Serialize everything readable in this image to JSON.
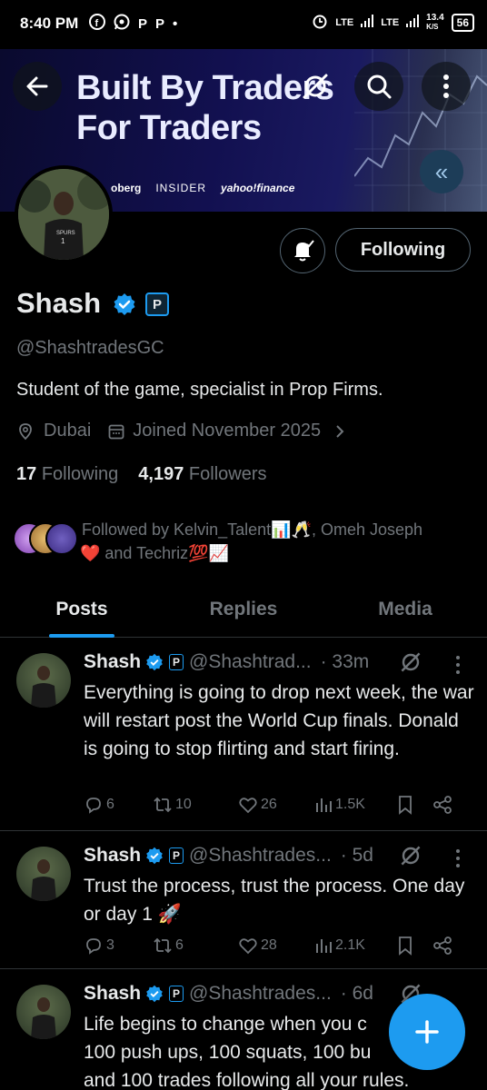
{
  "status_bar": {
    "time": "8:40 PM",
    "app_icons": [
      "facebook-icon",
      "whatsapp-icon",
      "p-icon",
      "p-icon",
      "dot"
    ],
    "p_letter": "P",
    "network1": "LTE",
    "network2": "LTE",
    "speed_value": "13.4",
    "speed_unit": "K/S",
    "battery": "56"
  },
  "banner": {
    "line1": "Built By Traders",
    "line2": "For Traders",
    "logos": [
      "oberg",
      "INSIDER",
      "yahoo!finance"
    ],
    "colors": {
      "bg": "#121050",
      "text": "#e9ecff"
    }
  },
  "header": {
    "back_icon": "arrow-left-icon",
    "grok_icon": "grok-icon",
    "search_icon": "search-icon",
    "more_icon": "more-vertical-icon",
    "collapse_icon": "double-chevron-left-icon",
    "collapse_glyph": "«"
  },
  "profile": {
    "name": "Shash",
    "badge_letter": "P",
    "handle": "@ShashtradesGC",
    "bio": "Student of the game, specialist in Prop Firms.",
    "location": "Dubai",
    "joined": "Joined November 2025",
    "following_count": "17",
    "following_label": "Following",
    "followers_count": "4,197",
    "followers_label": "Followers",
    "followed_by_line1": "Followed by Kelvin_Talent📊🥂, Omeh Joseph",
    "followed_by_line2": "❤️ and Techriz💯📈",
    "follow_button": "Following",
    "accent": "#1d9bf0"
  },
  "tabs": [
    {
      "label": "Posts",
      "active": true
    },
    {
      "label": "Replies",
      "active": false
    },
    {
      "label": "Media",
      "active": false
    }
  ],
  "posts": [
    {
      "name": "Shash",
      "handle": "@Shashtrad...",
      "time": "· 33m",
      "text": "Everything is going to drop next week, the war will restart post the World Cup finals. Donald is going to stop flirting and start firing.",
      "replies": "6",
      "reposts": "10",
      "likes": "26",
      "views": "1.5K"
    },
    {
      "name": "Shash",
      "handle": "@Shashtrades...",
      "time": "· 5d",
      "text": "Trust the process, trust the process. One day or day 1 🚀",
      "replies": "3",
      "reposts": "6",
      "likes": "28",
      "views": "2.1K"
    },
    {
      "name": "Shash",
      "handle": "@Shashtrades...",
      "time": "· 6d",
      "text_line1": "Life begins to change when you c",
      "text_line2": "100 push ups, 100 squats, 100 bu",
      "text_line3": "and 100 trades following all your rules."
    }
  ],
  "fab": {
    "icon": "plus-icon",
    "glyph": "+"
  }
}
